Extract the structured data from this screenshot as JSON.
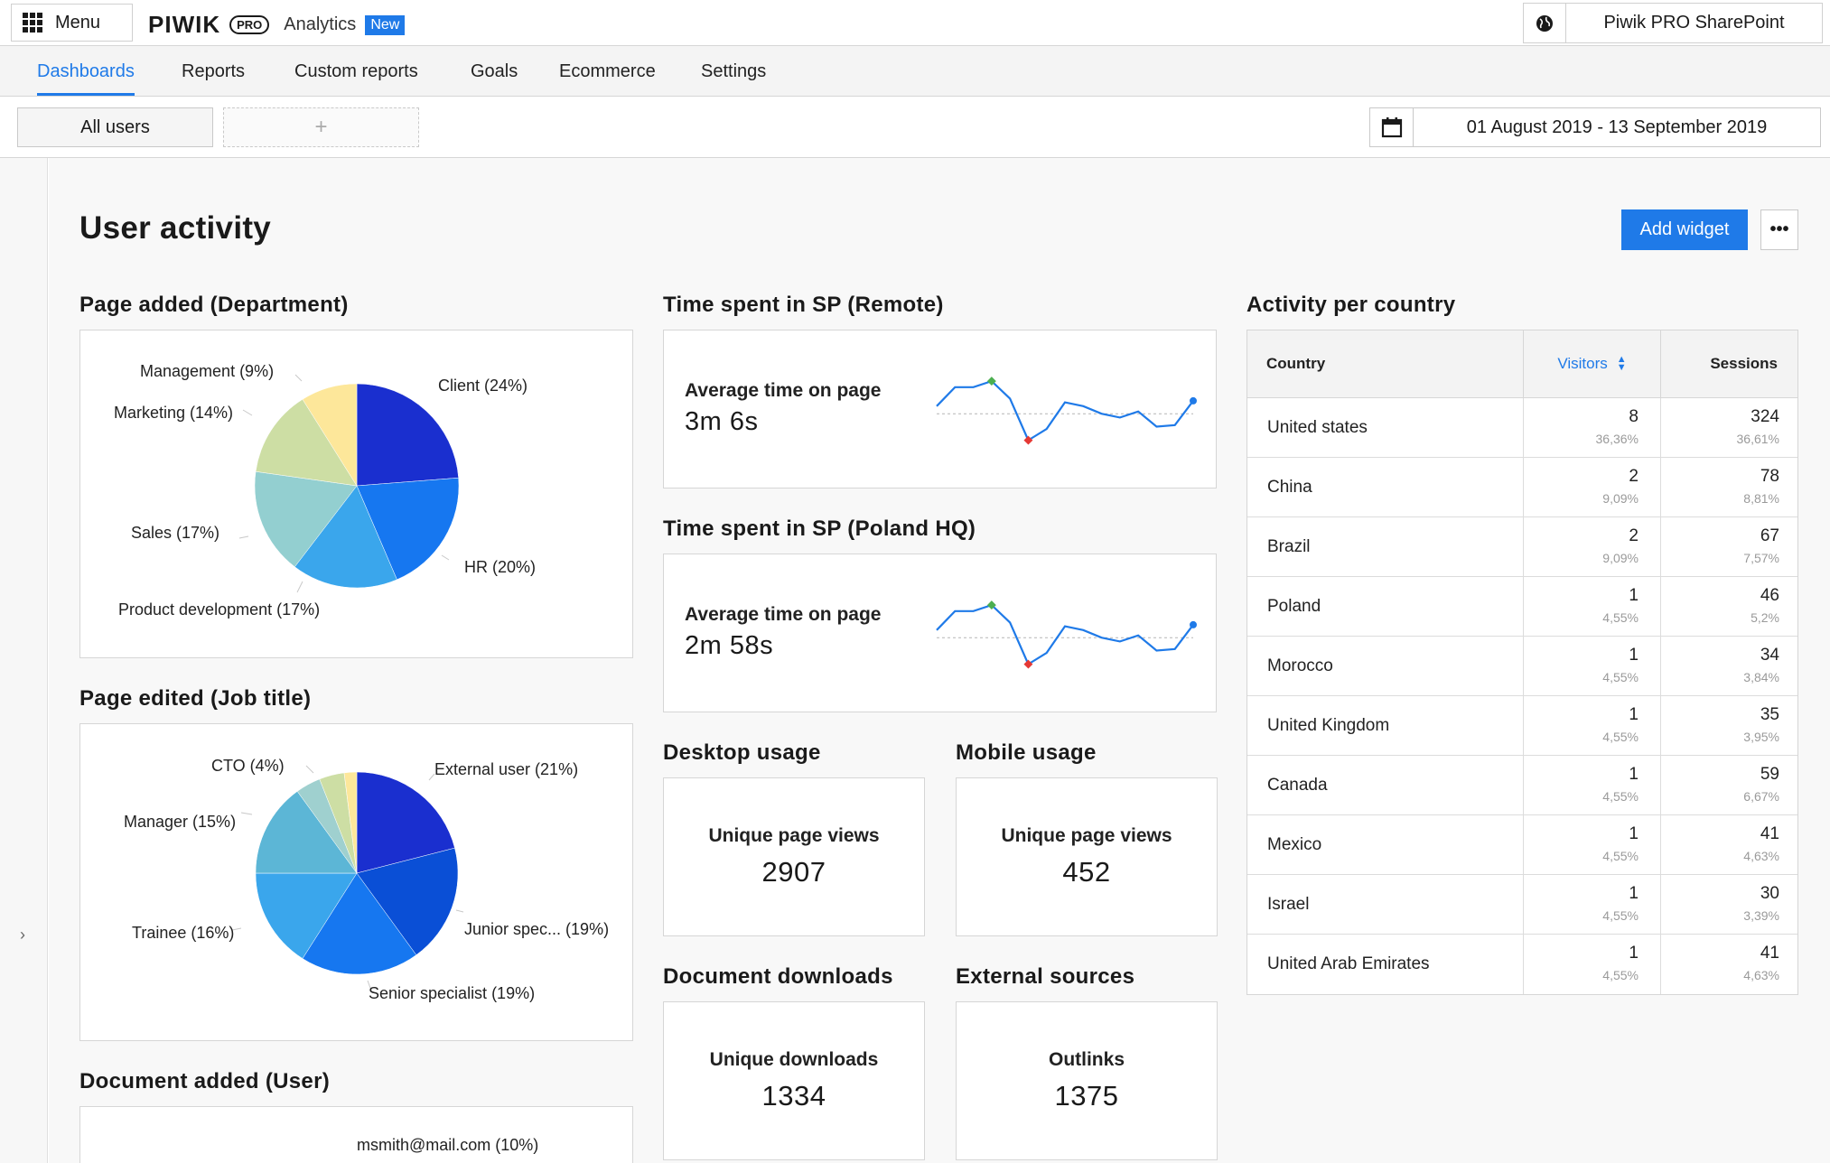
{
  "topbar": {
    "menu_label": "Menu",
    "logo_word": "PIWIK",
    "logo_pro": "PRO",
    "app_name": "Analytics",
    "new_badge": "New",
    "site_name": "Piwik PRO SharePoint"
  },
  "nav": {
    "tabs": [
      {
        "label": "Dashboards",
        "active": true
      },
      {
        "label": "Reports",
        "active": false
      },
      {
        "label": "Custom reports",
        "active": false
      },
      {
        "label": "Goals",
        "active": false
      },
      {
        "label": "Ecommerce",
        "active": false
      },
      {
        "label": "Settings",
        "active": false
      }
    ]
  },
  "filters": {
    "segment": "All users",
    "add_segment": "+",
    "date_range": "01 August 2019 - 13 September 2019"
  },
  "dashboard": {
    "title": "User activity",
    "add_widget": "Add widget",
    "more": "•••"
  },
  "widgets": {
    "page_added": {
      "title": "Page added (Department)",
      "labels": [
        "Client (24%)",
        "HR (20%)",
        "Product development (17%)",
        "Sales (17%)",
        "Marketing (14%)",
        "Management (9%)"
      ]
    },
    "page_edited": {
      "title": "Page edited (Job title)",
      "labels": [
        "External user (21%)",
        "Junior spec... (19%)",
        "Senior specialist (19%)",
        "Trainee (16%)",
        "Manager (15%)",
        "CTO (4%)"
      ]
    },
    "document_added": {
      "title": "Document added (User)",
      "labels": [
        "msmith@mail.com (10%)"
      ]
    },
    "time_remote": {
      "title": "Time spent in SP (Remote)",
      "metric_label": "Average time on page",
      "metric_value": "3m 6s"
    },
    "time_poland": {
      "title": "Time spent in SP (Poland HQ)",
      "metric_label": "Average time on page",
      "metric_value": "2m 58s"
    },
    "desktop": {
      "title": "Desktop usage",
      "metric_label": "Unique page views",
      "metric_value": "2907"
    },
    "mobile": {
      "title": "Mobile usage",
      "metric_label": "Unique page views",
      "metric_value": "452"
    },
    "downloads": {
      "title": "Document downloads",
      "metric_label": "Unique downloads",
      "metric_value": "1334"
    },
    "external": {
      "title": "External sources",
      "metric_label": "Outlinks",
      "metric_value": "1375"
    },
    "country": {
      "title": "Activity per country",
      "headers": {
        "country": "Country",
        "visitors": "Visitors",
        "sessions": "Sessions"
      },
      "rows": [
        {
          "country": "United states",
          "visitors": "8",
          "visitors_pct": "36,36%",
          "sessions": "324",
          "sessions_pct": "36,61%"
        },
        {
          "country": "China",
          "visitors": "2",
          "visitors_pct": "9,09%",
          "sessions": "78",
          "sessions_pct": "8,81%"
        },
        {
          "country": "Brazil",
          "visitors": "2",
          "visitors_pct": "9,09%",
          "sessions": "67",
          "sessions_pct": "7,57%"
        },
        {
          "country": "Poland",
          "visitors": "1",
          "visitors_pct": "4,55%",
          "sessions": "46",
          "sessions_pct": "5,2%"
        },
        {
          "country": "Morocco",
          "visitors": "1",
          "visitors_pct": "4,55%",
          "sessions": "34",
          "sessions_pct": "3,84%"
        },
        {
          "country": "United Kingdom",
          "visitors": "1",
          "visitors_pct": "4,55%",
          "sessions": "35",
          "sessions_pct": "3,95%"
        },
        {
          "country": "Canada",
          "visitors": "1",
          "visitors_pct": "4,55%",
          "sessions": "59",
          "sessions_pct": "6,67%"
        },
        {
          "country": "Mexico",
          "visitors": "1",
          "visitors_pct": "4,55%",
          "sessions": "41",
          "sessions_pct": "4,63%"
        },
        {
          "country": "Israel",
          "visitors": "1",
          "visitors_pct": "4,55%",
          "sessions": "30",
          "sessions_pct": "3,39%"
        },
        {
          "country": "United Arab Emirates",
          "visitors": "1",
          "visitors_pct": "4,55%",
          "sessions": "41",
          "sessions_pct": "4,63%"
        }
      ]
    }
  },
  "colors": {
    "accent": "#1f7ae8",
    "pie_department": [
      "#1a2fcf",
      "#1677f0",
      "#3aa6ec",
      "#93cfd0",
      "#cddea4",
      "#fde79a"
    ],
    "pie_job": [
      "#1a2fcf",
      "#0a4fd6",
      "#1677f0",
      "#3aa6ec",
      "#5cb6d6",
      "#9fd0cf",
      "#cddea4",
      "#fde79a"
    ],
    "sparkline": "#1f7ae8",
    "spark_max": "#4caf50",
    "spark_min": "#e53935"
  },
  "chart_data": [
    {
      "type": "pie",
      "title": "Page added (Department)",
      "categories": [
        "Client",
        "HR",
        "Product development",
        "Sales",
        "Marketing",
        "Management"
      ],
      "values": [
        24,
        20,
        17,
        17,
        14,
        9
      ]
    },
    {
      "type": "pie",
      "title": "Page edited (Job title)",
      "categories": [
        "External user",
        "Junior spec...",
        "Senior specialist",
        "Trainee",
        "Manager",
        "",
        "CTO",
        ""
      ],
      "values": [
        21,
        19,
        19,
        16,
        15,
        4,
        4,
        2
      ]
    },
    {
      "type": "line",
      "title": "Time spent in SP (Remote)",
      "values": [
        0.55,
        0.8,
        0.8,
        0.88,
        0.65,
        0.1,
        0.25,
        0.6,
        0.55,
        0.45,
        0.4,
        0.48,
        0.28,
        0.3,
        0.62
      ],
      "reference": 0.45
    },
    {
      "type": "line",
      "title": "Time spent in SP (Poland HQ)",
      "values": [
        0.55,
        0.8,
        0.8,
        0.88,
        0.65,
        0.1,
        0.25,
        0.6,
        0.55,
        0.45,
        0.4,
        0.48,
        0.28,
        0.3,
        0.62
      ],
      "reference": 0.45
    }
  ]
}
